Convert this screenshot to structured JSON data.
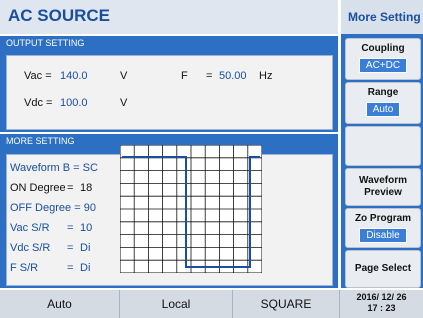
{
  "header": {
    "title": "AC SOURCE",
    "right_title": "More Setting"
  },
  "output_setting": {
    "label": "OUTPUT SETTING",
    "vac_label": "Vac =",
    "vac_value": "140.0",
    "vac_unit": "V",
    "f_label": "F",
    "f_eq": "=",
    "f_value": "50.00",
    "f_unit": "Hz",
    "vdc_label": "Vdc =",
    "vdc_value": "100.0",
    "vdc_unit": "V"
  },
  "more_setting": {
    "label": "MORE SETTING",
    "rows": [
      {
        "label": "Waveform B",
        "eq": "=",
        "value": "SC"
      },
      {
        "label": "ON Degree",
        "eq": "=",
        "value": "18"
      },
      {
        "label": "OFF Degree",
        "eq": "=",
        "value": "90"
      },
      {
        "label": "Vac S/R",
        "eq": "=",
        "value": "10"
      },
      {
        "label": "Vdc S/R",
        "eq": "=",
        "value": "Di"
      },
      {
        "label": "F S/R",
        "eq": "=",
        "value": "Di"
      }
    ]
  },
  "side_buttons": {
    "coupling": {
      "label": "Coupling",
      "value": "AC+DC"
    },
    "range": {
      "label": "Range",
      "value": "Auto"
    },
    "waveform_preview": {
      "label_line1": "Waveform",
      "label_line2": "Preview"
    },
    "zo_program": {
      "label": "Zo Program",
      "value": "Disable"
    },
    "page_select": {
      "label": "Page Select"
    }
  },
  "status_bar": {
    "mode": "Auto",
    "control": "Local",
    "waveform": "SQUARE",
    "date": "2016/ 12/ 26",
    "time": "17 : 23"
  },
  "colors": {
    "accent_blue": "#2d6fc3",
    "title_blue": "#1a4fa0",
    "wave_line": "#1a4fa0"
  }
}
